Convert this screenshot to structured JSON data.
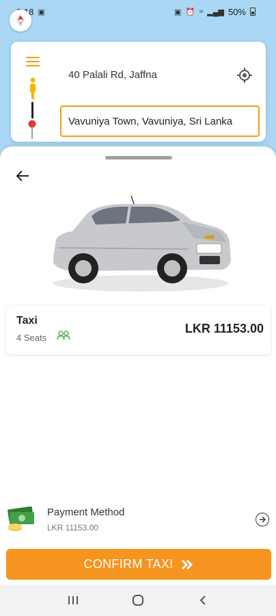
{
  "status_bar": {
    "time": "2:18",
    "battery": "50%"
  },
  "address": {
    "pickup": "40 Palali Rd, Jaffna",
    "destination": "Vavuniya Town, Vavuniya, Sri Lanka"
  },
  "vehicle": {
    "name": "Taxi",
    "seats": "4 Seats",
    "price": "LKR 11153.00"
  },
  "payment": {
    "title": "Payment Method",
    "amount": "LKR 11153.00"
  },
  "confirm": {
    "label": "CONFIRM TAXI"
  },
  "colors": {
    "accent": "#f5941f",
    "map": "#a9d7f4"
  },
  "icons": {
    "menu": "menu-icon",
    "pickup": "person-pin-icon",
    "destination": "drop-pin-icon",
    "location": "gps-target-icon",
    "back": "arrow-left-icon",
    "seats": "people-icon",
    "cash": "cash-stack-icon",
    "payment_next": "circle-arrow-right-icon",
    "confirm": "double-chevron-right-icon"
  }
}
